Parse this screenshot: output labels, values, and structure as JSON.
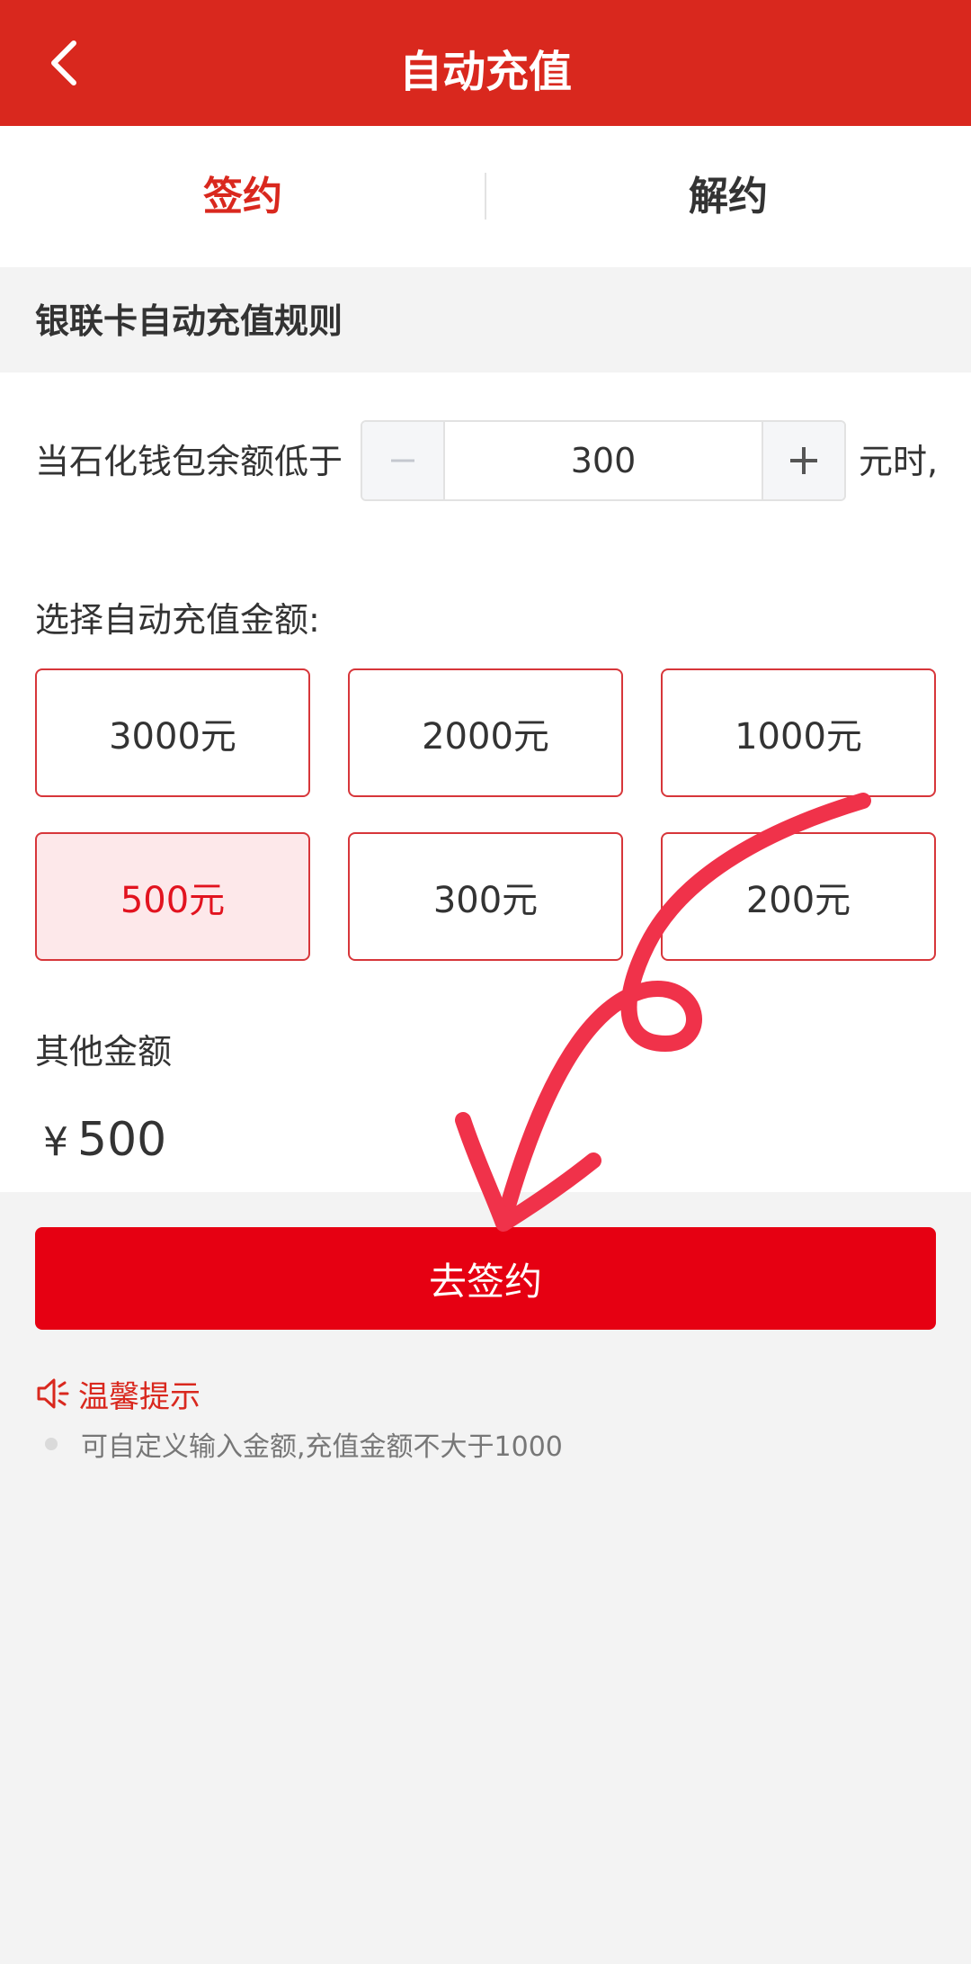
{
  "header": {
    "title": "自动充值"
  },
  "tabs": [
    {
      "label": "签约",
      "active": true
    },
    {
      "label": "解约",
      "active": false
    }
  ],
  "rules": {
    "title": "银联卡自动充值规则"
  },
  "threshold": {
    "label": "当石化钱包余额低于",
    "value": "300",
    "suffix": "元时,"
  },
  "choose": {
    "label": "选择自动充值金额:"
  },
  "amounts": [
    {
      "label": "3000元",
      "selected": false
    },
    {
      "label": "2000元",
      "selected": false
    },
    {
      "label": "1000元",
      "selected": false
    },
    {
      "label": "500元",
      "selected": true
    },
    {
      "label": "300元",
      "selected": false
    },
    {
      "label": "200元",
      "selected": false
    }
  ],
  "other": {
    "label": "其他金额",
    "currency": "¥",
    "value": "500"
  },
  "submit": {
    "label": "去签约"
  },
  "tips": {
    "title": "温馨提示",
    "items": [
      "可自定义输入金额,充值金额不大于1000"
    ]
  },
  "colors": {
    "brand": "#d9281e",
    "button": "#e60012",
    "annotation": "#f0324a"
  }
}
